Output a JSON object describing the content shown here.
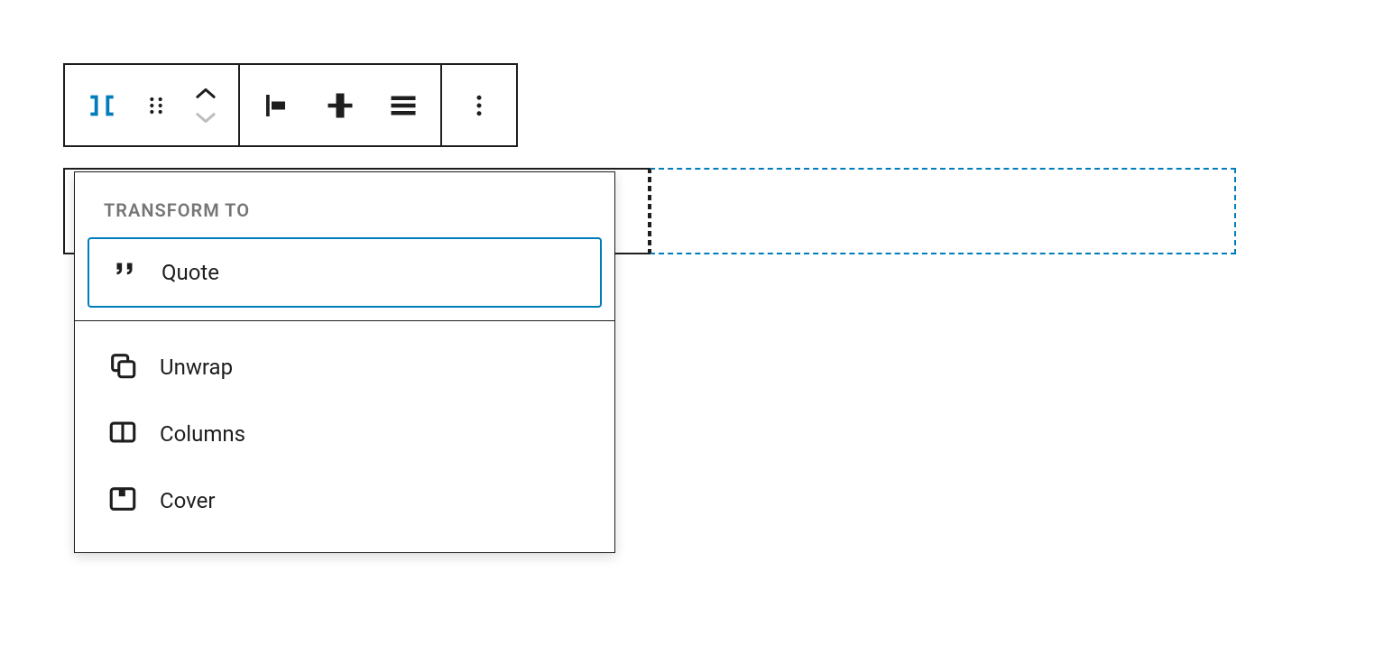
{
  "colors": {
    "accent": "#007cba",
    "ink": "#1e1e1e",
    "muted": "#757575"
  },
  "toolbar": {
    "block_icon": "row-icon",
    "drag_icon": "drag-handle-icon",
    "move_up_icon": "chevron-up-icon",
    "move_down_icon": "chevron-down-icon",
    "align_left_label": "align-left",
    "align_center_label": "align-center-vert",
    "justify_label": "justify",
    "more_label": "more-options"
  },
  "popover": {
    "heading": "TRANSFORM TO",
    "items_top": [
      {
        "label": "Quote",
        "icon": "quote-icon",
        "highlighted": true
      }
    ],
    "items_bottom": [
      {
        "label": "Unwrap",
        "icon": "unwrap-icon",
        "highlighted": false
      },
      {
        "label": "Columns",
        "icon": "columns-icon",
        "highlighted": false
      },
      {
        "label": "Cover",
        "icon": "cover-icon",
        "highlighted": false
      }
    ]
  }
}
